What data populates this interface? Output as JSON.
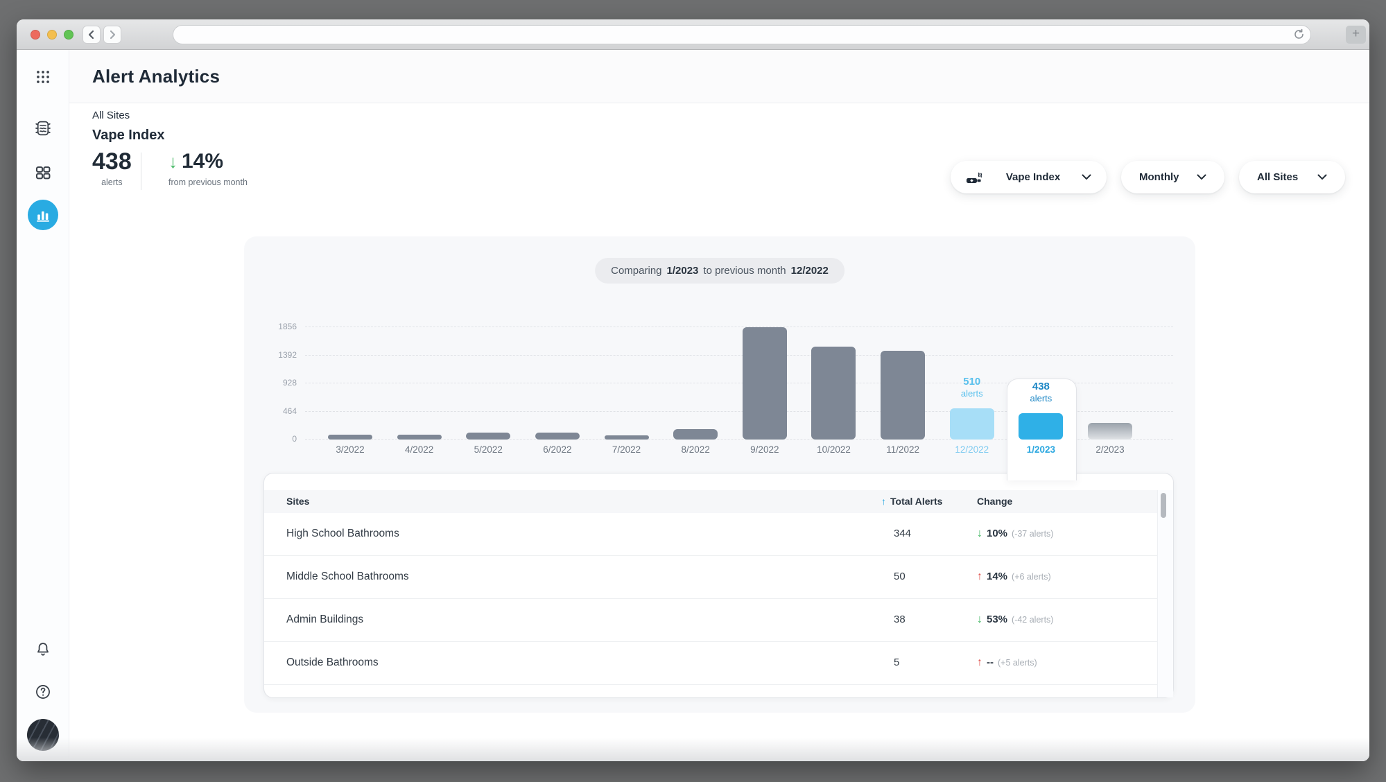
{
  "browser": {
    "url_value": "",
    "new_tab_label": "+"
  },
  "icons": {
    "down_arrow": "↓",
    "up_arrow": "↑"
  },
  "colors": {
    "accent_blue": "#29ABE2",
    "bar_gray": "#7E8795",
    "bar_previous": "#A7DEF7",
    "bar_current": "#2FB0E7",
    "label_blue_light": "#58C0ED",
    "label_blue_dark": "#1D87C5",
    "positive_green": "#3BB45C",
    "negative_red": "#E0524D"
  },
  "header": {
    "title": "Alert Analytics",
    "context": "All Sites"
  },
  "metric": {
    "title": "Vape Index",
    "value": "438",
    "unit": "alerts",
    "direction": "down",
    "change_pct": "14%",
    "change_note": "from previous month"
  },
  "filters": [
    {
      "id": "metric",
      "label": "Vape Index",
      "icon": "vape-icon"
    },
    {
      "id": "period",
      "label": "Monthly"
    },
    {
      "id": "sites",
      "label": "All Sites"
    }
  ],
  "compare": {
    "prefix": "Comparing",
    "current": "1/2023",
    "middle": "to previous month",
    "previous": "12/2022"
  },
  "chart_data": {
    "type": "bar",
    "title": "Vape Index",
    "categories": [
      "3/2022",
      "4/2022",
      "5/2022",
      "6/2022",
      "7/2022",
      "8/2022",
      "9/2022",
      "10/2022",
      "11/2022",
      "12/2022",
      "1/2023",
      "2/2023"
    ],
    "values": [
      75,
      75,
      110,
      110,
      55,
      170,
      1856,
      1540,
      1470,
      510,
      438,
      270
    ],
    "yticks": [
      0,
      464,
      928,
      1392,
      1856
    ],
    "ylim": [
      0,
      1856
    ],
    "xlabel": "",
    "ylabel": "",
    "grid": "dashed-horizontal",
    "legend": "none",
    "bar_styles": {
      "12/2022": "previous",
      "1/2023": "current",
      "2/2023": "future"
    },
    "annotations": [
      {
        "category": "12/2022",
        "value": "510",
        "unit": "alerts",
        "style": "previous"
      },
      {
        "category": "1/2023",
        "value": "438",
        "unit": "alerts",
        "style": "current"
      }
    ]
  },
  "table": {
    "columns": [
      {
        "label": "Sites"
      },
      {
        "label": "Total Alerts",
        "sort": "ascending"
      },
      {
        "label": "Change"
      }
    ],
    "rows": [
      {
        "site": "High School Bathrooms",
        "total": "344",
        "direction": "down",
        "pct": "10%",
        "delta": "(-37 alerts)"
      },
      {
        "site": "Middle School Bathrooms",
        "total": "50",
        "direction": "up",
        "pct": "14%",
        "delta": "(+6 alerts)"
      },
      {
        "site": "Admin Buildings",
        "total": "38",
        "direction": "down",
        "pct": "53%",
        "delta": "(-42 alerts)"
      },
      {
        "site": "Outside Bathrooms",
        "total": "5",
        "direction": "up",
        "pct": "--",
        "delta": "(+5 alerts)"
      }
    ]
  }
}
